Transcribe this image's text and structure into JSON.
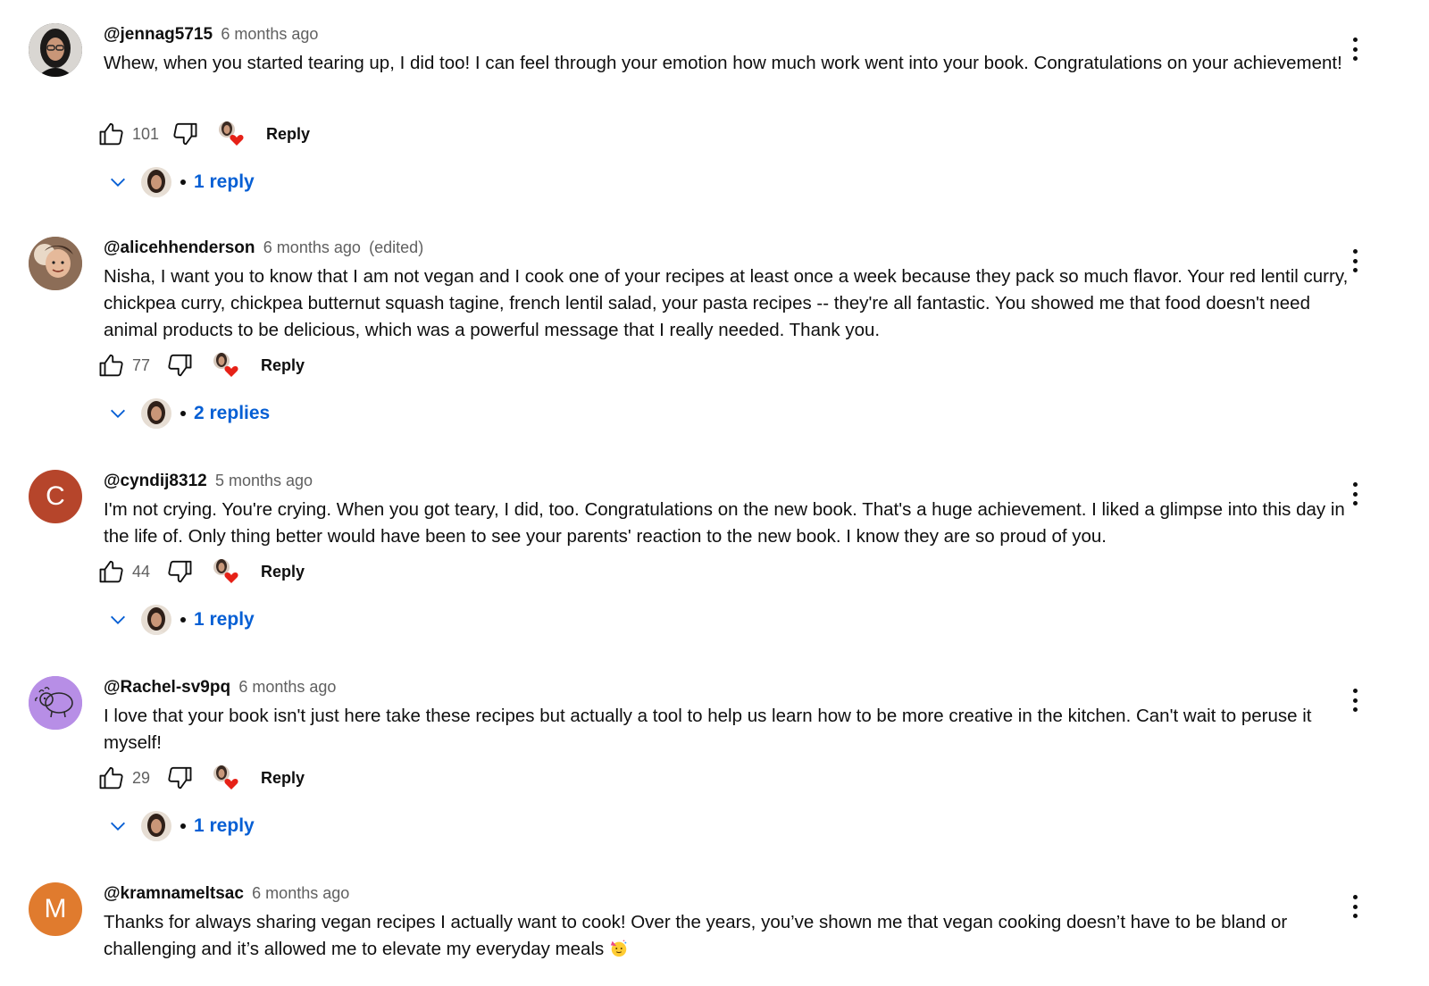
{
  "comments": [
    {
      "author": "@jennag5715",
      "time": "6 months ago",
      "edited": "",
      "avatar_type": "photo",
      "avatar_color": "#2b2b2b",
      "text": "Whew, when you started tearing up, I did too! I can feel through your emotion how much work went into your book. Congratulations on your achievement!",
      "likes": "101",
      "reply_label": "Reply",
      "replies_label": "1 reply"
    },
    {
      "author": "@alicehhenderson",
      "time": "6 months ago",
      "edited": "(edited)",
      "avatar_type": "photo",
      "avatar_color": "#b08a6e",
      "text": "Nisha, I want you to know that I am not vegan and I cook one of your recipes at least once a week because they pack so much flavor. Your red lentil curry, chickpea curry, chickpea butternut squash tagine, french lentil salad, your pasta recipes -- they're all fantastic. You showed me that food doesn't need animal products to be delicious, which was a powerful message that I really needed. Thank you.",
      "likes": "77",
      "reply_label": "Reply",
      "replies_label": "2 replies"
    },
    {
      "author": "@cyndij8312",
      "time": "5 months ago",
      "edited": "",
      "avatar_type": "letter",
      "avatar_letter": "C",
      "avatar_color": "#b6452b",
      "text": "I'm not crying. You're crying. When you got teary, I did, too. Congratulations on the new book. That's a huge achievement. I liked a glimpse into this day in the life of. Only thing better would have been to see your parents' reaction to the new book. I know they are so proud of you.",
      "likes": "44",
      "reply_label": "Reply",
      "replies_label": "1 reply"
    },
    {
      "author": "@Rachel-sv9pq",
      "time": "6 months ago",
      "edited": "",
      "avatar_type": "drawing",
      "avatar_color": "#b78ee6",
      "text": "I love that your book isn't just here take these recipes but actually a tool to help us learn how to be more creative in the kitchen.  Can't wait to peruse it myself!",
      "likes": "29",
      "reply_label": "Reply",
      "replies_label": "1 reply"
    },
    {
      "author": "@kramnameltsac",
      "time": "6 months ago",
      "edited": "",
      "avatar_type": "letter",
      "avatar_letter": "M",
      "avatar_color": "#e07b2e",
      "text": "Thanks for always sharing vegan recipes I actually want to cook! Over the years, you’ve shown me that vegan cooking doesn’t have to be bland or challenging and it’s allowed me to elevate my everyday meals",
      "emoji_icon": "partying-face-emoji"
    }
  ],
  "colors": {
    "link_blue": "#065fd4",
    "meta_gray": "#606060",
    "heart_red": "#e62117"
  }
}
